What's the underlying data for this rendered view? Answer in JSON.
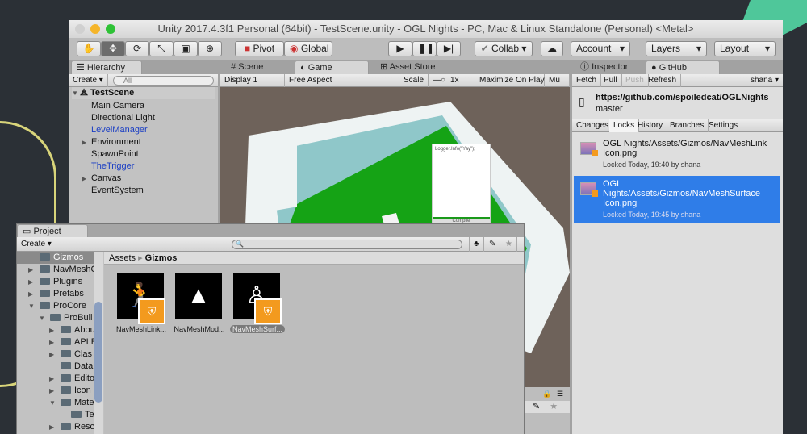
{
  "window": {
    "title": "Unity 2017.4.3f1 Personal (64bit) - TestScene.unity - OGL Nights - PC, Mac & Linux Standalone (Personal) <Metal>"
  },
  "toolbar": {
    "pivot": "Pivot",
    "global": "Global",
    "collab": "Collab ▾",
    "account": "Account",
    "layers": "Layers",
    "layout": "Layout",
    "dropdown": "▾"
  },
  "hierarchy": {
    "tab": "Hierarchy",
    "create": "Create ▾",
    "search_placeholder": "All",
    "scene": "TestScene",
    "items": [
      {
        "label": "Main Camera",
        "prefab": false,
        "expandable": false
      },
      {
        "label": "Directional Light",
        "prefab": false,
        "expandable": false
      },
      {
        "label": "LevelManager",
        "prefab": true,
        "expandable": false
      },
      {
        "label": "Environment",
        "prefab": false,
        "expandable": true
      },
      {
        "label": "SpawnPoint",
        "prefab": false,
        "expandable": false
      },
      {
        "label": "TheTrigger",
        "prefab": true,
        "expandable": false
      },
      {
        "label": "Canvas",
        "prefab": false,
        "expandable": true
      },
      {
        "label": "EventSystem",
        "prefab": false,
        "expandable": false
      }
    ]
  },
  "center": {
    "tabs": [
      {
        "label": "Scene"
      },
      {
        "label": "Game"
      },
      {
        "label": "Asset Store"
      }
    ],
    "active_tab": "Game",
    "display": "Display 1",
    "aspect": "Free Aspect",
    "scale_label": "Scale",
    "scale_value": "1x",
    "maximize": "Maximize On Play",
    "mute": "Mu",
    "game": {
      "logger_text": "Logger.Info(\"Yay\");",
      "compile": "Compile"
    }
  },
  "right": {
    "tabs": [
      {
        "label": "Inspector"
      },
      {
        "label": "GitHub"
      }
    ],
    "active_tab": "GitHub",
    "actions": [
      "Fetch",
      "Pull",
      "Push",
      "Refresh"
    ],
    "disabled_action": "Push",
    "user": "shana ▾",
    "repo_url": "https://github.com/spoiledcat/OGLNights",
    "branch": "master",
    "subtabs": [
      "Changes",
      "Locks",
      "History",
      "Branches",
      "Settings"
    ],
    "active_subtab": "Locks",
    "locks": [
      {
        "path": "OGL Nights/Assets/Gizmos/NavMeshLink Icon.png",
        "info": "Locked Today, 19:40 by shana",
        "selected": false
      },
      {
        "path": "OGL Nights/Assets/Gizmos/NavMeshSurface Icon.png",
        "info": "Locked Today, 19:45 by shana",
        "selected": true
      }
    ],
    "selection_color": "#2f7de8"
  },
  "project": {
    "title": "Project",
    "create": "Create ▾",
    "breadcrumb": [
      "Assets",
      "Gizmos"
    ],
    "tree": [
      {
        "label": "Gizmos",
        "depth": 0,
        "expand": "",
        "selected": true
      },
      {
        "label": "NavMeshC",
        "depth": 0,
        "expand": "closed"
      },
      {
        "label": "Plugins",
        "depth": 0,
        "expand": "closed"
      },
      {
        "label": "Prefabs",
        "depth": 0,
        "expand": "closed"
      },
      {
        "label": "ProCore",
        "depth": 0,
        "expand": "open"
      },
      {
        "label": "ProBuil",
        "depth": 1,
        "expand": "open"
      },
      {
        "label": "Abou",
        "depth": 2,
        "expand": "closed"
      },
      {
        "label": "API E",
        "depth": 2,
        "expand": "closed"
      },
      {
        "label": "Clas",
        "depth": 2,
        "expand": "closed"
      },
      {
        "label": "Data",
        "depth": 2,
        "expand": ""
      },
      {
        "label": "Edito",
        "depth": 2,
        "expand": "closed"
      },
      {
        "label": "Icon",
        "depth": 2,
        "expand": "closed"
      },
      {
        "label": "Mate",
        "depth": 2,
        "expand": "open"
      },
      {
        "label": "Te",
        "depth": 3,
        "expand": ""
      },
      {
        "label": "Resc",
        "depth": 2,
        "expand": "closed"
      }
    ],
    "assets": [
      {
        "label": "NavMeshLink...",
        "icon": "jumping-figure-icon",
        "locked": true,
        "selected": false
      },
      {
        "label": "NavMeshMod...",
        "icon": "tree-modifier-icon",
        "locked": false,
        "selected": false
      },
      {
        "label": "NavMeshSurf...",
        "icon": "surface-figure-icon",
        "locked": true,
        "selected": true
      }
    ],
    "lock_badge_color": "#f39a1e"
  }
}
